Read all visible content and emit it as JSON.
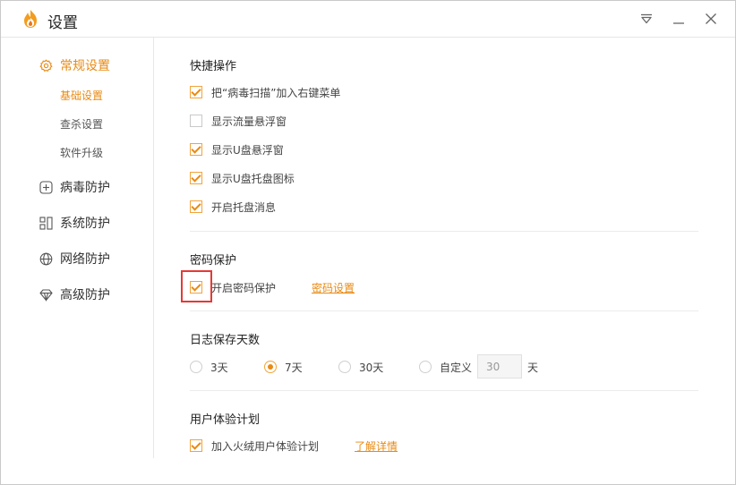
{
  "window": {
    "title": "设置"
  },
  "colors": {
    "accent": "#e98a12",
    "highlight": "#e53935"
  },
  "sidebar": {
    "groups": [
      {
        "label": "常规设置",
        "icon": "gear-icon",
        "active": true,
        "subitems": [
          {
            "label": "基础设置",
            "active": true
          },
          {
            "label": "查杀设置"
          },
          {
            "label": "软件升级"
          }
        ]
      },
      {
        "label": "病毒防护",
        "icon": "plus-square-icon"
      },
      {
        "label": "系统防护",
        "icon": "grid-icon"
      },
      {
        "label": "网络防护",
        "icon": "globe-icon"
      },
      {
        "label": "高级防护",
        "icon": "diamond-icon"
      }
    ]
  },
  "sections": {
    "shortcuts": {
      "title": "快捷操作",
      "items": [
        {
          "label": "把“病毒扫描”加入右键菜单",
          "checked": true
        },
        {
          "label": "显示流量悬浮窗",
          "checked": false
        },
        {
          "label": "显示U盘悬浮窗",
          "checked": true
        },
        {
          "label": "显示U盘托盘图标",
          "checked": true
        },
        {
          "label": "开启托盘消息",
          "checked": true
        }
      ]
    },
    "password": {
      "title": "密码保护",
      "item": {
        "label": "开启密码保护",
        "checked": true
      },
      "link": "密码设置"
    },
    "log": {
      "title": "日志保存天数",
      "options": [
        {
          "label": "3天",
          "checked": false
        },
        {
          "label": "7天",
          "checked": true
        },
        {
          "label": "30天",
          "checked": false
        },
        {
          "label": "自定义",
          "checked": false
        }
      ],
      "custom_value": "30",
      "unit": "天"
    },
    "experience": {
      "title": "用户体验计划",
      "item": {
        "label": "加入火绒用户体验计划",
        "checked": true
      },
      "link": "了解详情"
    }
  }
}
